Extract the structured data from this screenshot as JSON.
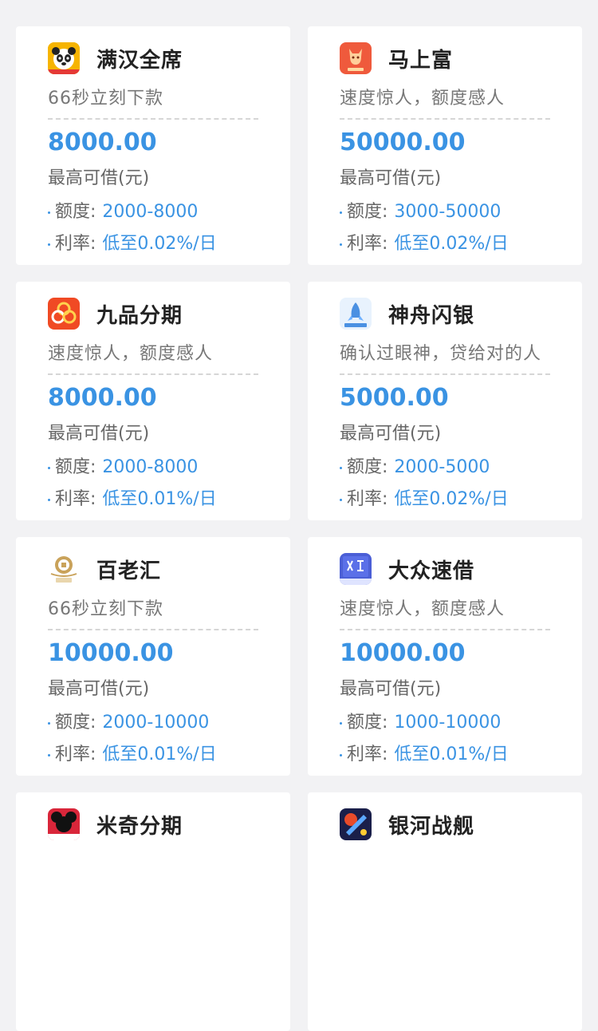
{
  "cards": [
    {
      "name": "",
      "slogan": "",
      "amount": "",
      "amount_label": "",
      "limit_label": "",
      "limit": "",
      "rate_label": "",
      "rate": "",
      "icon": ""
    },
    {
      "name": "",
      "slogan": "",
      "amount": "",
      "amount_label": "",
      "limit_label": "",
      "limit": "",
      "rate_label": "",
      "rate": "",
      "icon": ""
    },
    {
      "name": "满汉全席",
      "slogan": "66秒立刻下款",
      "amount": "8000.00",
      "amount_label": "最高可借(元)",
      "limit_label": "额度:",
      "limit": "2000-8000",
      "rate_label": "利率:",
      "rate": "低至0.02%/日",
      "icon": "panda-logo-icon"
    },
    {
      "name": "马上富",
      "slogan": "速度惊人，额度感人",
      "amount": "50000.00",
      "amount_label": "最高可借(元)",
      "limit_label": "额度:",
      "limit": "3000-50000",
      "rate_label": "利率:",
      "rate": "低至0.02%/日",
      "icon": "horse-logo-icon"
    },
    {
      "name": "九品分期",
      "slogan": "速度惊人，额度感人",
      "amount": "8000.00",
      "amount_label": "最高可借(元)",
      "limit_label": "额度:",
      "limit": "2000-8000",
      "rate_label": "利率:",
      "rate": "低至0.01%/日",
      "icon": "jiupin-logo-icon"
    },
    {
      "name": "神舟闪银",
      "slogan": "确认过眼神，贷给对的人",
      "amount": "5000.00",
      "amount_label": "最高可借(元)",
      "limit_label": "额度:",
      "limit": "2000-5000",
      "rate_label": "利率:",
      "rate": "低至0.02%/日",
      "icon": "rocket-logo-icon"
    },
    {
      "name": "百老汇",
      "slogan": "66秒立刻下款",
      "amount": "10000.00",
      "amount_label": "最高可借(元)",
      "limit_label": "额度:",
      "limit": "2000-10000",
      "rate_label": "利率:",
      "rate": "低至0.01%/日",
      "icon": "coin-logo-icon"
    },
    {
      "name": "大众速借",
      "slogan": "速度惊人，额度感人",
      "amount": "10000.00",
      "amount_label": "最高可借(元)",
      "limit_label": "额度:",
      "limit": "1000-10000",
      "rate_label": "利率:",
      "rate": "低至0.01%/日",
      "icon": "dazhong-logo-icon"
    },
    {
      "name": "米奇分期",
      "slogan": "",
      "amount": "",
      "amount_label": "",
      "limit_label": "",
      "limit": "",
      "rate_label": "",
      "rate": "",
      "icon": "mickey-logo-icon"
    },
    {
      "name": "银河战舰",
      "slogan": "",
      "amount": "",
      "amount_label": "",
      "limit_label": "",
      "limit": "",
      "rate_label": "",
      "rate": "",
      "icon": "battleship-logo-icon"
    }
  ],
  "colors": {
    "accent": "#3a93e3",
    "background": "#f2f2f4"
  }
}
